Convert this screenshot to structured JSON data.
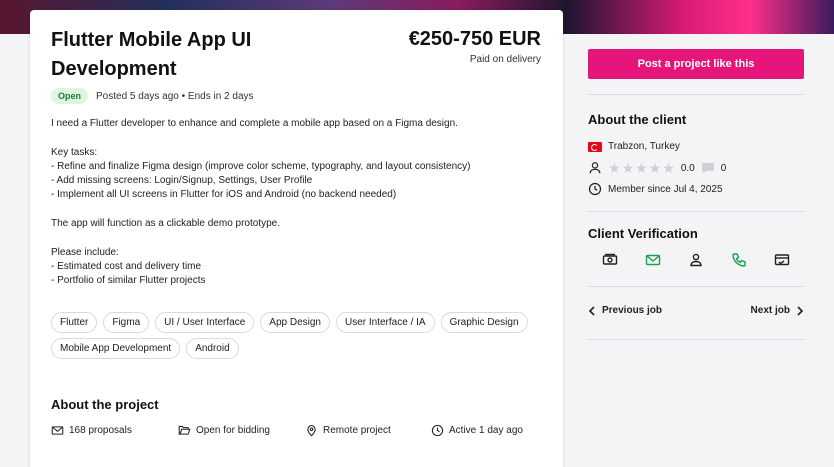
{
  "project": {
    "title": "Flutter Mobile App UI Development",
    "budget": "€250-750 EUR",
    "payment": "Paid on delivery",
    "status": "Open",
    "posted": "Posted 5 days ago • Ends in 2 days",
    "description": [
      "I need a Flutter developer to enhance and complete a mobile app based on a Figma design.",
      "",
      "Key tasks:",
      "- Refine and finalize Figma design (improve color scheme, typography, and layout consistency)",
      "- Add missing screens: Login/Signup, Settings, User Profile",
      "- Implement all UI screens in Flutter for iOS and Android (no backend needed)",
      "",
      "The app will function as a clickable demo prototype.",
      "",
      "Please include:",
      "- Estimated cost and delivery time",
      "- Portfolio of similar Flutter projects"
    ],
    "tags": [
      "Flutter",
      "Figma",
      "UI / User Interface",
      "App Design",
      "User Interface / IA",
      "Graphic Design",
      "Mobile App Development",
      "Android"
    ],
    "about_title": "About the project",
    "facts": {
      "proposals": "168 proposals",
      "bidding": "Open for bidding",
      "location": "Remote project",
      "activity": "Active 1 day ago"
    }
  },
  "sidebar": {
    "post_button": "Post a project like this",
    "client_title": "About the client",
    "location": "Trabzon, Turkey",
    "rating": "0.0",
    "reviews": "0",
    "member_since": "Member since Jul 4, 2025",
    "verification_title": "Client Verification",
    "prev_job": "Previous job",
    "next_job": "Next job"
  },
  "colors": {
    "accent": "#e5157a",
    "open_badge_bg": "#dff5e4",
    "open_badge_text": "#1f7a3a",
    "verified": "#1f9d55"
  },
  "icons": {
    "verification": [
      "payment-verified-icon",
      "email-verified-icon",
      "profile-verified-icon",
      "phone-verified-icon",
      "deposit-verified-icon"
    ]
  }
}
